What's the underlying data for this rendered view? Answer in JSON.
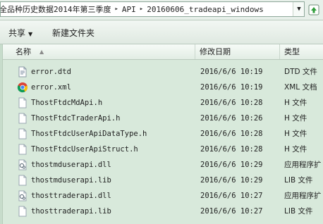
{
  "address": {
    "crumbs": [
      "全品种历史数据2014年第三季度",
      "API",
      "20160606_tradeapi_windows"
    ]
  },
  "toolbar": {
    "share_label": "共享",
    "new_folder_label": "新建文件夹"
  },
  "columns": {
    "name": "名称",
    "date": "修改日期",
    "type": "类型"
  },
  "files": [
    {
      "name": "error.dtd",
      "date": "2016/6/6 10:19",
      "type": "DTD 文件",
      "icon": "dtd-file-icon"
    },
    {
      "name": "error.xml",
      "date": "2016/6/6 10:19",
      "type": "XML 文档",
      "icon": "chrome-xml-icon"
    },
    {
      "name": "ThostFtdcMdApi.h",
      "date": "2016/6/6 10:28",
      "type": "H 文件",
      "icon": "header-file-icon"
    },
    {
      "name": "ThostFtdcTraderApi.h",
      "date": "2016/6/6 10:26",
      "type": "H 文件",
      "icon": "header-file-icon"
    },
    {
      "name": "ThostFtdcUserApiDataType.h",
      "date": "2016/6/6 10:28",
      "type": "H 文件",
      "icon": "header-file-icon"
    },
    {
      "name": "ThostFtdcUserApiStruct.h",
      "date": "2016/6/6 10:28",
      "type": "H 文件",
      "icon": "header-file-icon"
    },
    {
      "name": "thostmduserapi.dll",
      "date": "2016/6/6 10:29",
      "type": "应用程序扩",
      "icon": "dll-file-icon"
    },
    {
      "name": "thostmduserapi.lib",
      "date": "2016/6/6 10:29",
      "type": "LIB 文件",
      "icon": "lib-file-icon"
    },
    {
      "name": "thosttraderapi.dll",
      "date": "2016/6/6 10:27",
      "type": "应用程序扩",
      "icon": "dll-file-icon"
    },
    {
      "name": "thosttraderapi.lib",
      "date": "2016/6/6 10:27",
      "type": "LIB 文件",
      "icon": "lib-file-icon"
    }
  ]
}
